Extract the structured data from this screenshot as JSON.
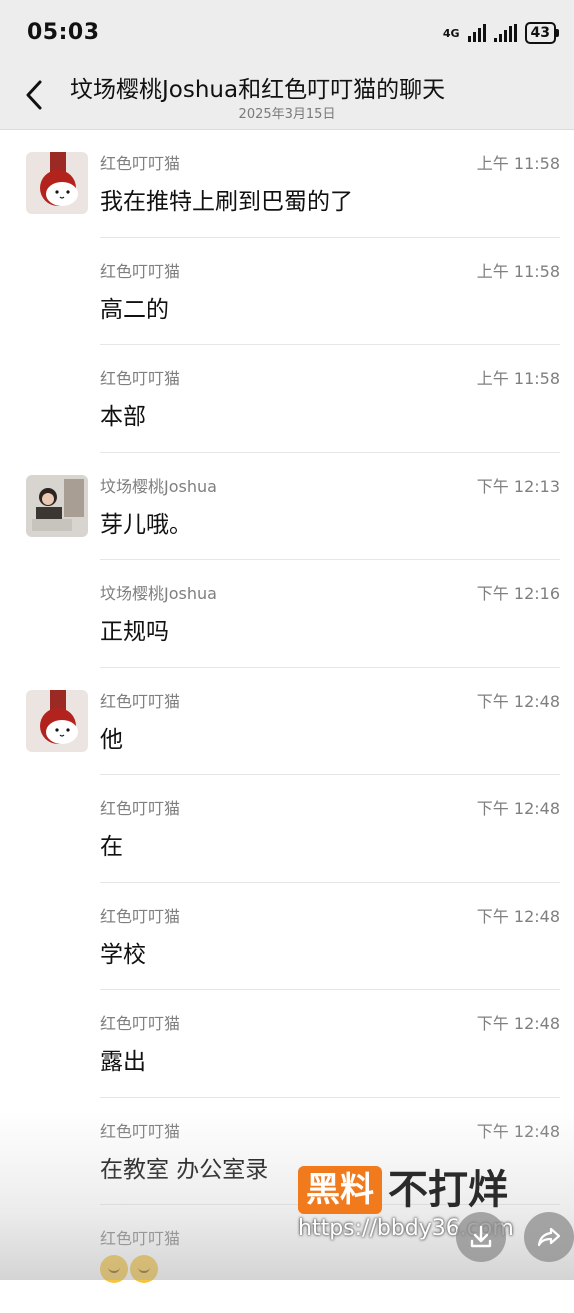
{
  "status_bar": {
    "time": "05:03",
    "network_label": "4G",
    "battery": "43"
  },
  "header": {
    "title": "坟场樱桃Joshua和红色叮叮猫的聊天",
    "date": "2025年3月15日"
  },
  "messages": [
    {
      "sender": "红色叮叮猫",
      "time": "上午 11:58",
      "text": "我在推特上刷到巴蜀的了",
      "avatar": "cat-red-hat"
    },
    {
      "sender": "红色叮叮猫",
      "time": "上午 11:58",
      "text": "高二的",
      "avatar": ""
    },
    {
      "sender": "红色叮叮猫",
      "time": "上午 11:58",
      "text": "本部",
      "avatar": ""
    },
    {
      "sender": "坟场樱桃Joshua",
      "time": "下午 12:13",
      "text": "芽儿哦。",
      "avatar": "person-photo"
    },
    {
      "sender": "坟场樱桃Joshua",
      "time": "下午 12:16",
      "text": "正规吗",
      "avatar": ""
    },
    {
      "sender": "红色叮叮猫",
      "time": "下午 12:48",
      "text": "他",
      "avatar": "cat-red-hat"
    },
    {
      "sender": "红色叮叮猫",
      "time": "下午 12:48",
      "text": "在",
      "avatar": ""
    },
    {
      "sender": "红色叮叮猫",
      "time": "下午 12:48",
      "text": "学校",
      "avatar": ""
    },
    {
      "sender": "红色叮叮猫",
      "time": "下午 12:48",
      "text": "露出",
      "avatar": ""
    },
    {
      "sender": "红色叮叮猫",
      "time": "下午 12:48",
      "text": "在教室 办公室录",
      "avatar": ""
    },
    {
      "sender": "红色叮叮猫",
      "time": "",
      "text": "",
      "avatar": "",
      "emojis": [
        "laughing-crying-emoji",
        "hot-sweat-emoji"
      ]
    }
  ],
  "watermark": {
    "badge": "黑料",
    "text": "不打烊",
    "url": "https://bbdy36.com"
  },
  "actions": {
    "download_icon": "download-icon",
    "share_icon": "share-icon"
  },
  "colors": {
    "header_bg": "#ededed",
    "watermark_orange": "#f07a1c"
  }
}
